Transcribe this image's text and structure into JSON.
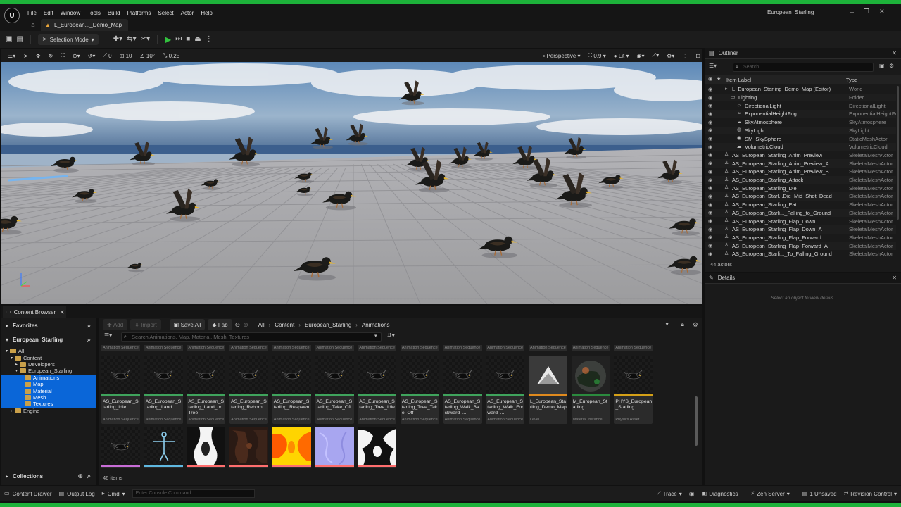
{
  "window": {
    "title": "European_Starling",
    "controls": [
      "–",
      "❐",
      "✕"
    ]
  },
  "menu": [
    "File",
    "Edit",
    "Window",
    "Tools",
    "Build",
    "Platforms",
    "Select",
    "Actor",
    "Help"
  ],
  "map_tab": "L_European..._Demo_Map",
  "toolbar": {
    "mode": "Selection Mode"
  },
  "viewport_bar": {
    "snap_rot": "0",
    "snap_grid": "10",
    "snap_angle": "10°",
    "scale": "0.25",
    "view": "Perspective",
    "fov": "0.9",
    "lit": "Lit"
  },
  "outliner": {
    "title": "Outliner",
    "search_placeholder": "Search...",
    "col_label": "Item Label",
    "col_type": "Type",
    "rows": [
      {
        "indent": 1,
        "icon": "▸",
        "name": "L_European_Starling_Demo_Map (Editor)",
        "type": "World"
      },
      {
        "indent": 2,
        "icon": "▭",
        "name": "Lighting",
        "type": "Folder"
      },
      {
        "indent": 3,
        "icon": "☼",
        "name": "DirectionalLight",
        "type": "DirectionalLight"
      },
      {
        "indent": 3,
        "icon": "≈",
        "name": "ExponentialHeightFog",
        "type": "ExponentialHeightFog"
      },
      {
        "indent": 3,
        "icon": "☁",
        "name": "SkyAtmosphere",
        "type": "SkyAtmosphere"
      },
      {
        "indent": 3,
        "icon": "◍",
        "name": "SkyLight",
        "type": "SkyLight"
      },
      {
        "indent": 3,
        "icon": "◉",
        "name": "SM_SkySphere",
        "type": "StaticMeshActor"
      },
      {
        "indent": 3,
        "icon": "☁",
        "name": "VolumetricCloud",
        "type": "VolumetricCloud"
      },
      {
        "indent": 1,
        "icon": "♙",
        "name": "AS_European_Starling_Anim_Preview",
        "type": "SkeletalMeshActor"
      },
      {
        "indent": 1,
        "icon": "♙",
        "name": "AS_European_Starling_Anim_Preview_A",
        "type": "SkeletalMeshActor"
      },
      {
        "indent": 1,
        "icon": "♙",
        "name": "AS_European_Starling_Anim_Preview_B",
        "type": "SkeletalMeshActor"
      },
      {
        "indent": 1,
        "icon": "♙",
        "name": "AS_European_Starling_Attack",
        "type": "SkeletalMeshActor"
      },
      {
        "indent": 1,
        "icon": "♙",
        "name": "AS_European_Starling_Die",
        "type": "SkeletalMeshActor"
      },
      {
        "indent": 1,
        "icon": "♙",
        "name": "AS_European_Starl...Die_Mid_Shot_Dead",
        "type": "SkeletalMeshActor"
      },
      {
        "indent": 1,
        "icon": "♙",
        "name": "AS_European_Starling_Eat",
        "type": "SkeletalMeshActor"
      },
      {
        "indent": 1,
        "icon": "♙",
        "name": "AS_European_Starli..._Falling_to_Ground",
        "type": "SkeletalMeshActor"
      },
      {
        "indent": 1,
        "icon": "♙",
        "name": "AS_European_Starling_Flap_Down",
        "type": "SkeletalMeshActor"
      },
      {
        "indent": 1,
        "icon": "♙",
        "name": "AS_European_Starling_Flap_Down_A",
        "type": "SkeletalMeshActor"
      },
      {
        "indent": 1,
        "icon": "♙",
        "name": "AS_European_Starling_Flap_Forward",
        "type": "SkeletalMeshActor"
      },
      {
        "indent": 1,
        "icon": "♙",
        "name": "AS_European_Starling_Flap_Forward_A",
        "type": "SkeletalMeshActor"
      },
      {
        "indent": 1,
        "icon": "♙",
        "name": "AS_European_Starli..._To_Falling_Ground",
        "type": "SkeletalMeshActor"
      }
    ],
    "count": "44 actors"
  },
  "details": {
    "title": "Details",
    "empty_msg": "Select an object to view details."
  },
  "content_browser": {
    "tab": "Content Browser",
    "favorites": "Favorites",
    "project": "European_Starling",
    "tree": [
      {
        "indent": 0,
        "label": "All",
        "sel": false
      },
      {
        "indent": 1,
        "label": "Content",
        "sel": false
      },
      {
        "indent": 2,
        "label": "Developers",
        "sel": false
      },
      {
        "indent": 2,
        "label": "European_Starling",
        "sel": false
      },
      {
        "indent": 3,
        "label": "Animations",
        "sel": true
      },
      {
        "indent": 3,
        "label": "Map",
        "sel": true
      },
      {
        "indent": 3,
        "label": "Material",
        "sel": true
      },
      {
        "indent": 3,
        "label": "Mesh",
        "sel": true
      },
      {
        "indent": 3,
        "label": "Textures",
        "sel": true
      },
      {
        "indent": 1,
        "label": "Engine",
        "sel": false
      }
    ],
    "collections": "Collections",
    "add": "Add",
    "import": "Import",
    "save_all": "Save All",
    "fab": "Fab",
    "path": [
      "All",
      "Content",
      "European_Starling",
      "Animations"
    ],
    "search_placeholder": "Search Animations, Map, Material, Mesh, Textures",
    "top_row_type": "Animation Sequence",
    "assets": [
      {
        "name": "AS_European_Starling_Idle",
        "type": "Animation Sequence",
        "bar": "#3fa35c",
        "thumb": "bird"
      },
      {
        "name": "AS_European_Starling_Land",
        "type": "Animation Sequence",
        "bar": "#3fa35c",
        "thumb": "bird"
      },
      {
        "name": "AS_European_Starling_Land_onTree",
        "type": "Animation Sequence",
        "bar": "#3fa35c",
        "thumb": "bird"
      },
      {
        "name": "AS_European_Starling_Reborn",
        "type": "Animation Sequence",
        "bar": "#3fa35c",
        "thumb": "bird"
      },
      {
        "name": "AS_European_Starling_Respawn",
        "type": "Animation Sequence",
        "bar": "#3fa35c",
        "thumb": "bird"
      },
      {
        "name": "AS_European_Starling_Take_Off",
        "type": "Animation Sequence",
        "bar": "#3fa35c",
        "thumb": "bird"
      },
      {
        "name": "AS_European_Starling_Tree_Idle",
        "type": "Animation Sequence",
        "bar": "#3fa35c",
        "thumb": "bird"
      },
      {
        "name": "AS_European_Starling_Tree_Take_Off",
        "type": "Animation Sequence",
        "bar": "#3fa35c",
        "thumb": "bird"
      },
      {
        "name": "AS_European_Starling_Walk_Backward_...",
        "type": "Animation Sequence",
        "bar": "#3fa35c",
        "thumb": "bird"
      },
      {
        "name": "AS_European_Starling_Walk_Forward_...",
        "type": "Animation Sequence",
        "bar": "#3fa35c",
        "thumb": "bird"
      },
      {
        "name": "L_European_Starling_Demo_Map",
        "type": "Level",
        "bar": "#e08a1e",
        "thumb": "level"
      },
      {
        "name": "M_European_Starling",
        "type": "Material Instance",
        "bar": "#2b8a3e",
        "thumb": "sphere"
      },
      {
        "name": "PHYS_European_Starling",
        "type": "Physics Asset",
        "bar": "#d4a017",
        "thumb": "bird"
      }
    ],
    "row2": [
      {
        "bar": "#c86dd7",
        "thumb": "bird"
      },
      {
        "bar": "#5fb8e0",
        "thumb": "skel"
      },
      {
        "bar": "#ff6e6e",
        "thumb": "tex_bw"
      },
      {
        "bar": "#ff6e6e",
        "thumb": "tex_dark"
      },
      {
        "bar": "#ff6e6e",
        "thumb": "tex_orange"
      },
      {
        "bar": "#ff6e6e",
        "thumb": "tex_normal"
      },
      {
        "bar": "#ff6e6e",
        "thumb": "tex_mask"
      }
    ],
    "count": "46 items"
  },
  "statusbar": {
    "drawer": "Content Drawer",
    "output": "Output Log",
    "cmd": "Cmd",
    "console_placeholder": "Enter Console Command",
    "trace": "Trace",
    "diagnostics": "Diagnostics",
    "zen": "Zen Server",
    "unsaved": "1 Unsaved",
    "revision": "Revision Control"
  },
  "colors": {
    "accent_green": "#1db23a",
    "selection_blue": "#0a66d8"
  }
}
